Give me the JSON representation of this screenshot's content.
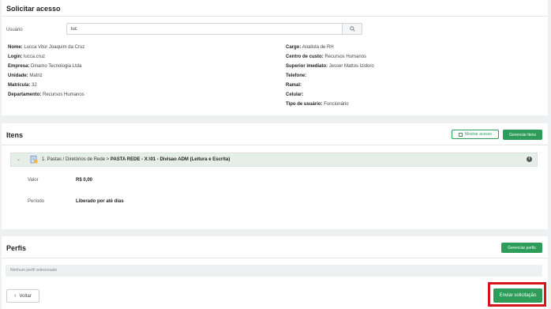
{
  "request": {
    "title": "Solicitar acesso",
    "user_label": "Usuário",
    "user_value": "luc",
    "left_fields": [
      {
        "label": "Nome:",
        "value": "Lucca Vitor Joaquim da Cruz"
      },
      {
        "label": "Login:",
        "value": "lucca.cruz"
      },
      {
        "label": "Empresa:",
        "value": "Dinamo Tecnologia Ltda"
      },
      {
        "label": "Unidade:",
        "value": "Matriz"
      },
      {
        "label": "Matrícula:",
        "value": "32"
      },
      {
        "label": "Departamento:",
        "value": "Recursos Humanos"
      }
    ],
    "right_fields": [
      {
        "label": "Cargo:",
        "value": "Analista de RH"
      },
      {
        "label": "Centro de custo:",
        "value": "Recursos Humanos"
      },
      {
        "label": "Superior imediato:",
        "value": "Jesser Mattos Izidoro"
      },
      {
        "label": "Telefone:",
        "value": ""
      },
      {
        "label": "Ramal:",
        "value": ""
      },
      {
        "label": "Celular:",
        "value": ""
      },
      {
        "label": "Tipo de usuário:",
        "value": "Funcionário"
      }
    ]
  },
  "items": {
    "title": "Itens",
    "show_access_label": "Mostrar acesso",
    "manage_items_label": "Gerenciar itens",
    "item_prefix": "1. Pastas / Diretórios de Rede > ",
    "item_name": "PASTA REDE - X:\\01 - Divisao ADM (Leitura e Escrita)",
    "value_label": "Valor",
    "value": "R$ 0,00",
    "period_label": "Período",
    "period": "Liberado por até dias"
  },
  "profiles": {
    "title": "Perfis",
    "manage_label": "Gerenciar perfis",
    "empty_text": "Nenhum perfil selecionado"
  },
  "footer": {
    "back_label": "Voltar",
    "submit_label": "Enviar solicitação"
  },
  "colors": {
    "accent_green": "#2e9d5a",
    "highlight_red": "#d6141b"
  }
}
